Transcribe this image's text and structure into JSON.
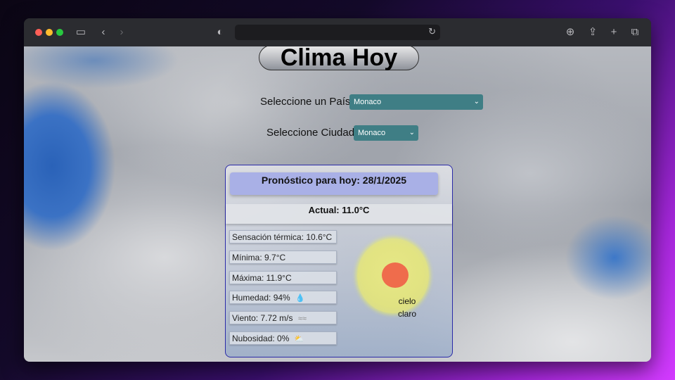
{
  "page": {
    "title": "Clima Hoy",
    "country_label": "Seleccione un País:",
    "country_value": "Monaco",
    "city_label": "Seleccione Ciudad:",
    "city_value": "Monaco"
  },
  "forecast": {
    "heading": "Pronóstico para hoy: 28/1/2025",
    "current": "Actual: 11.0°C",
    "stats": [
      {
        "label": "Sensación térmica: 10.6°C",
        "icon": ""
      },
      {
        "label": "Mínima: 9.7°C",
        "icon": ""
      },
      {
        "label": "Máxima: 11.9°C",
        "icon": ""
      },
      {
        "label": "Humedad: 94%",
        "icon": "droplet-icon"
      },
      {
        "label": "Viento: 7.72 m/s",
        "icon": "wind-icon"
      },
      {
        "label": "Nubosidad: 0%",
        "icon": "sun-cloud-icon"
      }
    ],
    "sky_line1": "cielo",
    "sky_line2": "claro"
  },
  "colors": {
    "select_bg": "#3f7e85",
    "card_border": "#2a2aa8",
    "card_header": "#a9b0e6",
    "sun_core": "#ef6c4c"
  }
}
